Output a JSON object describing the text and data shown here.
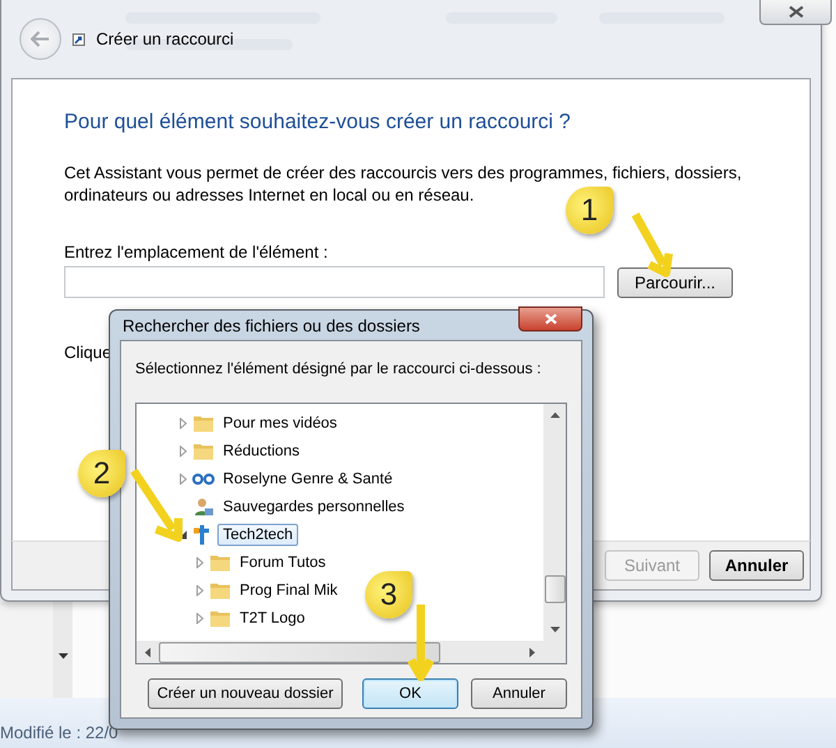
{
  "wizard": {
    "title": "Créer un raccourci",
    "heading": "Pour quel élément souhaitez-vous créer un raccourci ?",
    "description": "Cet Assistant vous permet de créer des raccourcis vers des programmes, fichiers, dossiers, ordinateurs ou adresses Internet en local ou en réseau.",
    "location_label": "Entrez l'emplacement de l'élément :",
    "browse_button": "Parcourir...",
    "instruction_partial": "Clique",
    "buttons": [
      {
        "label": "Suivant",
        "disabled": true
      },
      {
        "label": "Annuler",
        "disabled": false
      }
    ]
  },
  "dialog": {
    "title": "Rechercher des fichiers ou des dossiers",
    "prompt": "Sélectionnez l'élément désigné par le raccourci ci-dessous :",
    "tree": [
      {
        "label": "Pour mes vidéos",
        "kind": "folder",
        "expanded": false,
        "selected": false
      },
      {
        "label": "Réductions",
        "kind": "folder",
        "expanded": false,
        "selected": false
      },
      {
        "label": "Roselyne Genre & Santé",
        "kind": "network",
        "expanded": false,
        "selected": false
      },
      {
        "label": "Sauvegardes personnelles",
        "kind": "user",
        "selected": false
      },
      {
        "label": "Tech2tech",
        "kind": "project",
        "expanded": true,
        "selected": true,
        "children": [
          {
            "label": "Forum Tutos",
            "kind": "folder",
            "expanded": false,
            "selected": false
          },
          {
            "label": "Prog Final Mik",
            "kind": "folder",
            "expanded": false,
            "selected": false
          },
          {
            "label": "T2T Logo",
            "kind": "folder",
            "expanded": false,
            "selected": false
          }
        ]
      }
    ],
    "buttons": [
      {
        "label": "Créer un nouveau dossier",
        "default": false
      },
      {
        "label": "OK",
        "default": true
      },
      {
        "label": "Annuler",
        "default": false
      }
    ]
  },
  "status_bar": {
    "text": "Modifié le : 22/0"
  },
  "callouts": [
    {
      "label": "1"
    },
    {
      "label": "2"
    },
    {
      "label": "3"
    }
  ]
}
